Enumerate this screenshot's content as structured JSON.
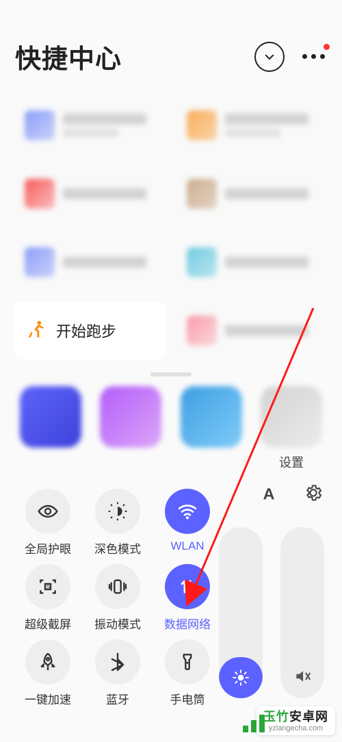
{
  "header": {
    "title": "快捷中心"
  },
  "cards": {
    "run_label": "开始跑步"
  },
  "apps": {
    "a4_label": "设置"
  },
  "qs": {
    "font_label": "A",
    "items": [
      {
        "label": "全局护眼",
        "active": false
      },
      {
        "label": "深色模式",
        "active": false
      },
      {
        "label": "WLAN",
        "active": true
      },
      {
        "label": "超级截屏",
        "active": false
      },
      {
        "label": "振动模式",
        "active": false
      },
      {
        "label": "数据网络",
        "active": true
      },
      {
        "label": "一键加速",
        "active": false
      },
      {
        "label": "蓝牙",
        "active": false
      },
      {
        "label": "手电筒",
        "active": false
      }
    ]
  },
  "watermark": {
    "brand_prefix": "玉竹",
    "brand_suffix": "安卓网",
    "domain": "yzlangecha.com"
  },
  "colors": {
    "accent": "#5b62ff",
    "annotation": "#ff1a1a"
  }
}
